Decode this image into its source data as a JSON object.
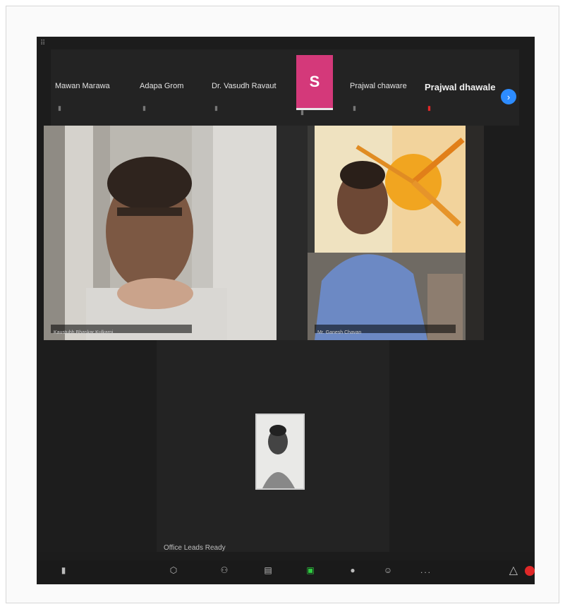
{
  "participants": [
    {
      "name": "Mawan Marawa",
      "style": "normal"
    },
    {
      "name": "Adapa Grom",
      "style": "normal"
    },
    {
      "name": "Dr. Vasudh Ravaut",
      "style": "normal"
    },
    {
      "name": "Prajwal chaware",
      "style": "normal"
    },
    {
      "name": "Prajwal dhawale",
      "style": "big"
    }
  ],
  "highlighted_tile": {
    "letter": "S"
  },
  "videos": [
    {
      "name": "Kaustubh Bhaskar Kulkarni"
    },
    {
      "name": "Mr. Ganesh Chavan"
    }
  ],
  "viewer_label": "Office Leads Ready",
  "toolbar": {
    "more": "..."
  }
}
